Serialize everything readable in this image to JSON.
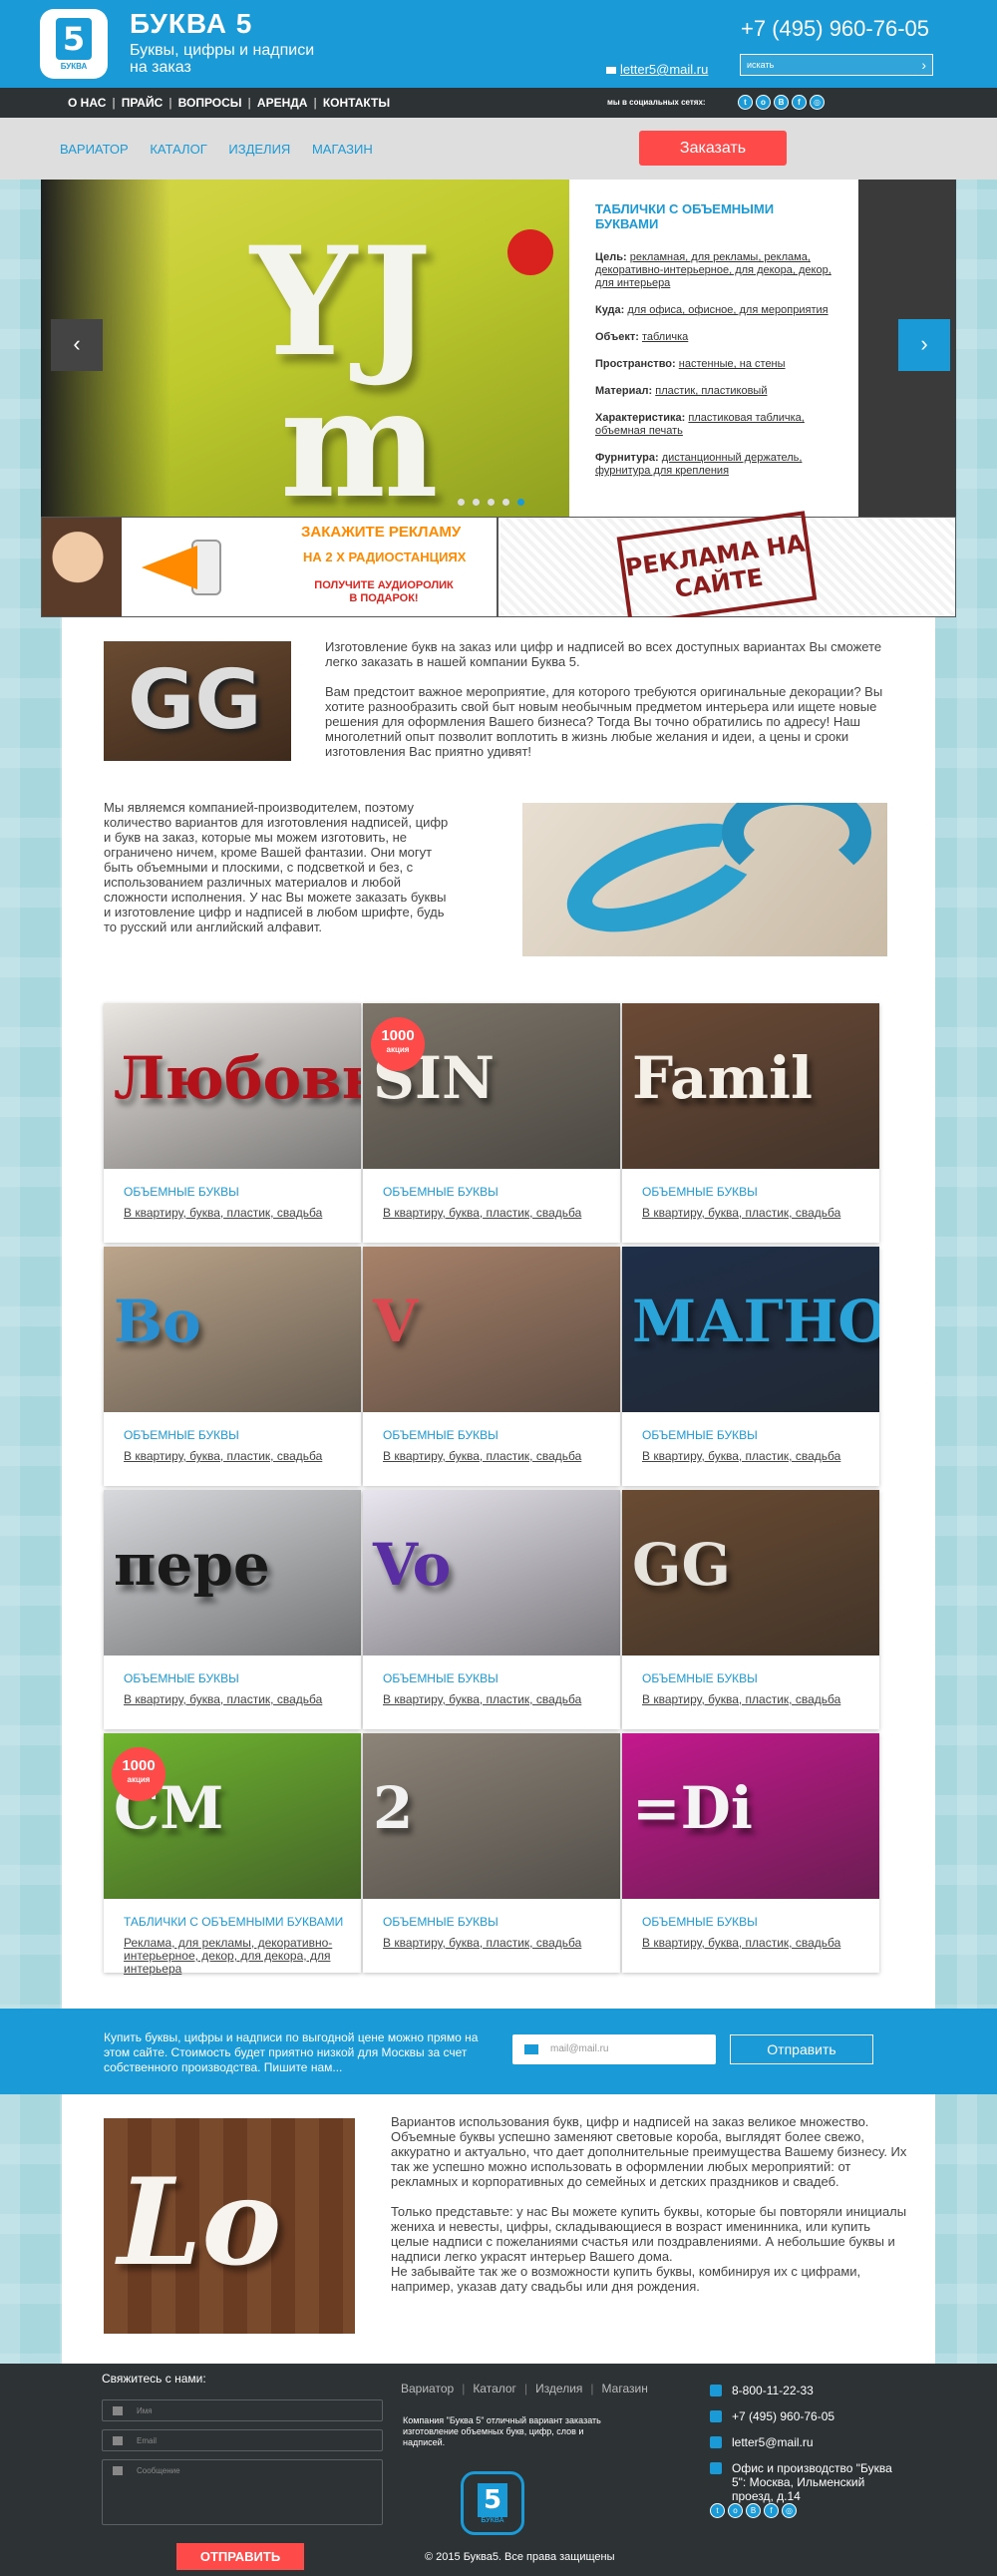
{
  "header": {
    "logo_digit": "5",
    "logo_text": "БУКВА",
    "brand_name": "БУКВА 5",
    "tagline": "Буквы, цифры и надписи на заказ",
    "phone": "+7 (495) 960-76-05",
    "email": "letter5@mail.ru",
    "search_placeholder": "искать",
    "search_arrow": "›"
  },
  "nav": {
    "items": [
      "О НАС",
      "ПРАЙС",
      "ВОПРОСЫ",
      "АРЕНДА",
      "КОНТАКТЫ"
    ],
    "social_label": "мы в социальных сетях:",
    "social_icons": [
      "twitter-icon",
      "odnoklassniki-icon",
      "vk-icon",
      "facebook-icon",
      "instagram-icon"
    ],
    "social_glyphs": [
      "t",
      "o",
      "B",
      "f",
      "◎"
    ]
  },
  "catbar": {
    "items": [
      "ВАРИАТОР",
      "КАТАЛОГ",
      "ИЗДЕЛИЯ",
      "МАГАЗИН"
    ],
    "order_button": "Заказать"
  },
  "slider": {
    "title": "ТАБЛИЧКИ С ОБЪЕМНЫМИ БУКВАМИ",
    "rows": [
      {
        "label": "Цель:",
        "value": "рекламная, для рекламы, реклама, декоративно-интерьерное, для декора, декор, для интерьера"
      },
      {
        "label": "Куда:",
        "value": "для офиса, офисное, для мероприятия"
      },
      {
        "label": "Объект:",
        "value": "табличка"
      },
      {
        "label": "Пространство:",
        "value": "настенные, на стены"
      },
      {
        "label": "Материал:",
        "value": "пластик, пластиковый"
      },
      {
        "label": "Характеристика:",
        "value": "пластиковая табличка, объемная печать"
      },
      {
        "label": "Фурнитура:",
        "value": "дистанционный держатель, фурнитура для крепления"
      }
    ],
    "prev": "‹",
    "next": "›",
    "slide_count": 5,
    "active_slide": 5
  },
  "banners": {
    "radio_line1": "ЗАКАЖИТЕ РЕКЛАМУ",
    "radio_line2": "НА 2 Х РАДИОСТАНЦИЯХ",
    "radio_line3": "ПОЛУЧИТЕ АУДИОРОЛИК В ПОДАРОК!",
    "site_stamp": "РЕКЛАМА НА САЙТЕ"
  },
  "intro": {
    "p1": "Изготовление букв на заказ или цифр и надписей во всех доступных вариантах Вы сможете легко заказать в нашей компании Буква 5.",
    "p2": "Вам предстоит важное мероприятие, для которого требуются оригинальные декорации? Вы хотите разнообразить свой быт новым необычным предметом интерьера или ищете новые решения для оформления Вашего бизнеса? Тогда Вы точно обратились по адресу! Наш многолетний опыт позволит воплотить в жизнь любые желания и идеи, а цены и сроки изготовления Вас приятно удивят!",
    "p3": "Мы являемся компанией-производителем, поэтому количество вариантов для изготовления надписей, цифр и букв на заказ, которые мы можем изготовить, не ограничено ничем, кроме Вашей фантазии. Они могут быть объемными и плоскими, с подсветкой и без, с использованием различных материалов и любой сложности исполнения. У нас Вы можете заказать буквы и изготовление цифр и надписей в любом шрифте, будь то русский или английский алфавит."
  },
  "products": [
    {
      "word": "Любовь",
      "bg": "#e9e5e1",
      "fg": "#b3121b",
      "category": "ОБЪЕМНЫЕ БУКВЫ",
      "tags": "В квартиру, буква, пластик, свадьба"
    },
    {
      "word": "SIN",
      "bg": "#7d7569",
      "fg": "#f2efe8",
      "badge": "1000",
      "badge_text": "акция",
      "category": "ОБЪЕМНЫЕ БУКВЫ",
      "tags": "В квартиру, буква, пластик, свадьба"
    },
    {
      "word": "Famil",
      "bg": "#6b4a35",
      "fg": "#f4f0e8",
      "category": "ОБЪЕМНЫЕ БУКВЫ",
      "tags": "В квартиру, буква, пластик, свадьба"
    },
    {
      "word": "Bo",
      "bg": "#bba48a",
      "fg": "#2a8fd0",
      "category": "ОБЪЕМНЫЕ БУКВЫ",
      "tags": "В квартиру, буква, пластик, свадьба"
    },
    {
      "word": "V",
      "bg": "#a8826a",
      "fg": "#d9494f",
      "category": "ОБЪЕМНЫЕ БУКВЫ",
      "tags": "В квартиру, буква, пластик, свадьба"
    },
    {
      "word": "МАГНО",
      "bg": "#1f2f48",
      "fg": "#2aa3d8",
      "category": "ОБЪЕМНЫЕ БУКВЫ",
      "tags": "В квартиру, буква, пластик, свадьба"
    },
    {
      "word": "пере",
      "bg": "#d7d9dc",
      "fg": "#1a1a1a",
      "category": "ОБЪЕМНЫЕ БУКВЫ",
      "tags": "В квартиру, буква, пластик, свадьба"
    },
    {
      "word": "Vo",
      "bg": "#e9e6ef",
      "fg": "#5a2ea3",
      "category": "ОБЪЕМНЫЕ БУКВЫ",
      "tags": "В квартиру, буква, пластик, свадьба"
    },
    {
      "word": "GG",
      "bg": "#6a4b32",
      "fg": "#e6e2dc",
      "category": "ОБЪЕМНЫЕ БУКВЫ",
      "tags": "В квартиру, буква, пластик, свадьба"
    },
    {
      "word": "CM",
      "bg": "#6fb52f",
      "fg": "#f3f3f3",
      "badge": "1000",
      "badge_text": "акция",
      "category": "ТАБЛИЧКИ С ОБЪЕМНЫМИ БУКВАМИ",
      "tags": "Реклама, для рекламы, декоративно-интерьерное, декор, для декора, для интерьера"
    },
    {
      "word": "2",
      "bg": "#8d8478",
      "fg": "#f1f1f1",
      "category": "ОБЪЕМНЫЕ БУКВЫ",
      "tags": "В квартиру, буква, пластик, свадьба"
    },
    {
      "word": "=Di",
      "bg": "#c4188d",
      "fg": "#f4f4f4",
      "category": "ОБЪЕМНЫЕ БУКВЫ",
      "tags": "В квартиру, буква, пластик, свадьба"
    }
  ],
  "subscribe": {
    "text": "Купить буквы, цифры и надписи по выгодной цене можно прямо на этом сайте. Стоимость будет приятно низкой для Москвы за счет собственного производства. Пишите нам...",
    "placeholder": "mail@mail.ru",
    "button": "Отправить"
  },
  "love": {
    "word": "Lo",
    "p1": "Вариантов использования букв, цифр и надписей на заказ великое множество. Объемные буквы успешно заменяют световые короба, выглядят более свежо, аккуратно и актуально, что дает дополнительные преимущества Вашему бизнесу. Их так же успешно можно использовать в оформлении любых мероприятий: от рекламных и корпоративных до семейных и детских праздников и свадеб.",
    "p2": "Только представьте: у нас Вы можете купить буквы, которые бы повторяли инициалы жениха и невесты, цифры, складывающиеся в возраст именинника, или купить целые надписи с пожеланиями счастья или поздравлениями. А небольшие буквы и надписи легко украсят интерьер Вашего дома.",
    "p3": "Не забывайте так же о возможности купить буквы, комбинируя их с цифрами, например, указав дату свадьбы или дня рождения."
  },
  "footer": {
    "contact_title": "Свяжитесь с нами:",
    "name_placeholder": "Имя",
    "email_placeholder": "Email",
    "message_placeholder": "Сообщение",
    "send_button": "ОТПРАВИТЬ",
    "links": [
      "Вариатор",
      "Каталог",
      "Изделия",
      "Магазин"
    ],
    "description": "Компания \"Буква 5\" отличный вариант заказать изготовление объемных букв, цифр, слов и надписей.",
    "copyright": "© 2015 Буква5. Все права защищены",
    "phone1": "8-800-11-22-33",
    "phone2": "+7 (495) 960-76-05",
    "email": "letter5@mail.ru",
    "address": "Офис и производство \"Буква 5\": Москва, Ильменский проезд, д.14"
  }
}
